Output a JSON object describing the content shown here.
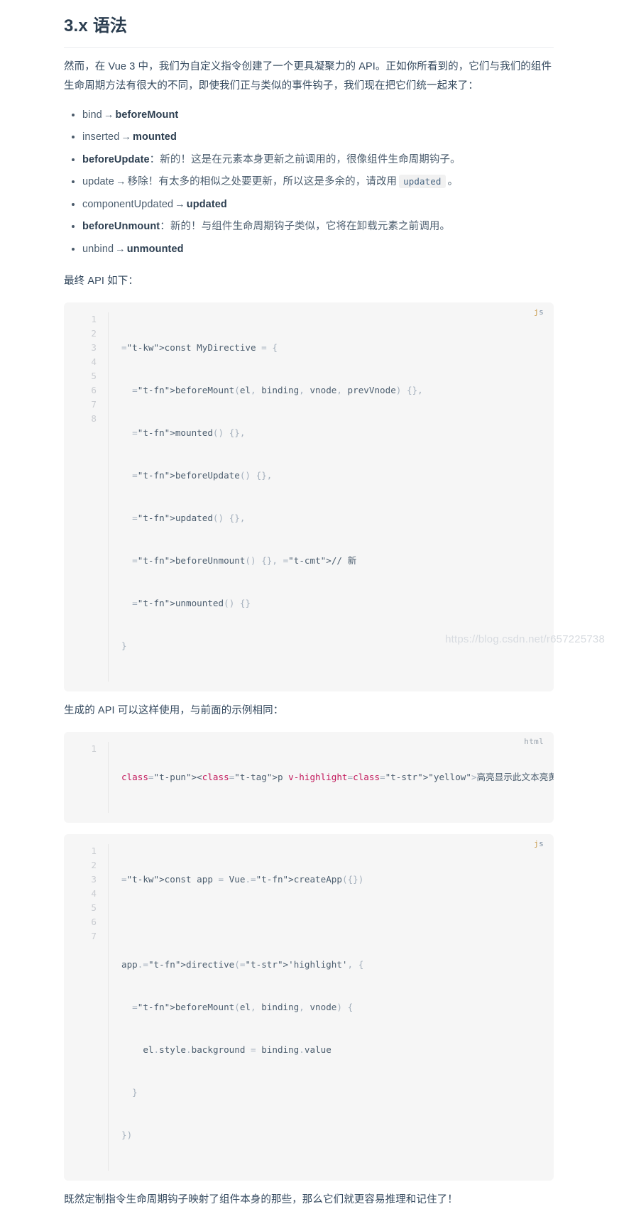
{
  "heading": "3.x 语法",
  "intro_paragraph": "然而，在 Vue 3 中，我们为自定义指令创建了一个更具凝聚力的 API。正如你所看到的，它们与我们的组件生命周期方法有很大的不同，即使我们正与类似的事件钩子，我们现在把它们统一起来了：",
  "hook_list": [
    {
      "old": "bind",
      "arrow": "→",
      "new": "beforeMount",
      "new_bold": true,
      "desc": ""
    },
    {
      "old": "inserted",
      "arrow": "→",
      "new": "mounted",
      "new_bold": true,
      "desc": ""
    },
    {
      "bold_lead": "beforeUpdate",
      "desc": "：新的！这是在元素本身更新之前调用的，很像组件生命周期钩子。"
    },
    {
      "old": "update",
      "arrow": "→",
      "new": "移除！有太多的相似之处要更新，所以这是多余的，请改用",
      "code": "updated",
      "tail": "。"
    },
    {
      "old": "componentUpdated",
      "arrow": "→",
      "new": "updated",
      "new_bold": true,
      "desc": ""
    },
    {
      "bold_lead": "beforeUnmount",
      "desc": "：新的！与组件生命周期钩子类似，它将在卸载元素之前调用。"
    },
    {
      "old": "unbind",
      "arrow": "→",
      "new": "unmounted",
      "new_bold": true,
      "desc": ""
    }
  ],
  "para_final_api": "最终 API 如下：",
  "code_block_1": {
    "lang": "js",
    "line_numbers": [
      "1",
      "2",
      "3",
      "4",
      "5",
      "6",
      "7",
      "8"
    ],
    "lines": [
      "const MyDirective = {",
      "  beforeMount(el, binding, vnode, prevVnode) {},",
      "  mounted() {},",
      "  beforeUpdate() {},",
      "  updated() {},",
      "  beforeUnmount() {}, // 新",
      "  unmounted() {}",
      "}"
    ]
  },
  "para_generated_api": "生成的 API 可以这样使用，与前面的示例相同：",
  "code_block_2": {
    "lang": "html",
    "line_numbers": [
      "1"
    ],
    "lines": [
      "<p v-highlight=\"yellow\">高亮显示此文本亮黄色</p>"
    ]
  },
  "code_block_3": {
    "lang": "js",
    "line_numbers": [
      "1",
      "2",
      "3",
      "4",
      "5",
      "6",
      "7"
    ],
    "lines": [
      "const app = Vue.createApp({})",
      "",
      "app.directive('highlight', {",
      "  beforeMount(el, binding, vnode) {",
      "    el.style.background = binding.value",
      "  }",
      "})"
    ]
  },
  "para_conclusion": "既然定制指令生命周期钩子映射了组件本身的那些，那么它们就更容易推理和记住了！",
  "watermark": "https://blog.csdn.net/r657225738",
  "colors": {
    "heading": "#2c3e50",
    "text": "#34495e",
    "code_bg": "#f6f6f6",
    "keyword": "#b5369c",
    "function": "#c4883a",
    "string": "#43a047",
    "tag": "#d6336c",
    "comment": "#9aa4ae"
  }
}
